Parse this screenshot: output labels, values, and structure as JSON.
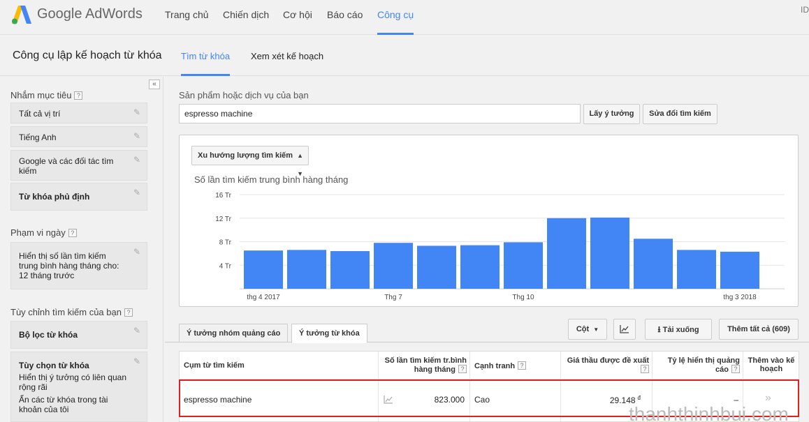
{
  "app": {
    "brand": "Google AdWords",
    "top_right": "ID"
  },
  "nav": {
    "items": [
      {
        "label": "Trang chủ",
        "active": false
      },
      {
        "label": "Chiến dịch",
        "active": false
      },
      {
        "label": "Cơ hội",
        "active": false
      },
      {
        "label": "Báo cáo",
        "active": false
      },
      {
        "label": "Công cụ",
        "active": true
      }
    ]
  },
  "subheader": {
    "title": "Công cụ lập kế hoạch từ khóa",
    "tabs": [
      {
        "label": "Tìm từ khóa",
        "active": true
      },
      {
        "label": "Xem xét kế hoạch",
        "active": false
      }
    ]
  },
  "sidebar": {
    "collapse": "«",
    "targeting": {
      "heading": "Nhắm mục tiêu",
      "help": "?",
      "items": [
        "Tất cả vị trí",
        "Tiếng Anh",
        "Google và các đối tác tìm kiếm",
        "Từ khóa phủ định"
      ]
    },
    "date_range": {
      "heading": "Phạm vi ngày",
      "help": "?",
      "text": "Hiển thị số lần tìm kiếm trung bình hàng tháng cho: 12 tháng trước"
    },
    "customize": {
      "heading": "Tùy chỉnh tìm kiếm của bạn",
      "help": "?",
      "filter": "Bộ lọc từ khóa",
      "options_title": "Tùy chọn từ khóa",
      "options_line1": "Hiển thị ý tưởng có liên quan rộng rãi",
      "options_line2": "Ẩn các từ khóa trong tài khoản của tôi"
    }
  },
  "search": {
    "label": "Sản phẩm hoặc dịch vụ của bạn",
    "value": "espresso machine",
    "get_ideas": "Lấy ý tưởng",
    "modify": "Sửa đổi tìm kiếm"
  },
  "chart": {
    "selector": "Xu hướng lượng tìm kiếm"
  },
  "chart_data": {
    "type": "bar",
    "title": "Số lần tìm kiếm trung bình hàng tháng",
    "yticks": [
      "4 Tr",
      "8 Tr",
      "12 Tr",
      "16 Tr"
    ],
    "ytick_values": [
      4,
      8,
      12,
      16
    ],
    "ylim": [
      0,
      16
    ],
    "xtick_labels": [
      "thg 4 2017",
      "Thg 7",
      "Thg 10",
      "thg 3 2018"
    ],
    "xtick_index": [
      0,
      3,
      6,
      11
    ],
    "values": [
      6.5,
      6.6,
      6.4,
      7.8,
      7.3,
      7.4,
      7.9,
      12,
      12.1,
      8.5,
      6.6,
      6.3
    ],
    "color": "#4285f4",
    "grid": true
  },
  "results": {
    "tabs": [
      {
        "label": "Ý tưởng nhóm quảng cáo",
        "active": false
      },
      {
        "label": "Ý tưởng từ khóa",
        "active": true
      }
    ],
    "columns_btn": "Cột",
    "download_btn": "Tải xuống",
    "add_all_btn": "Thêm tất cả (609)",
    "headers": {
      "keyword": "Cụm từ tìm kiếm",
      "volume_l1": "Số lần tìm kiếm tr.bình",
      "volume_l2": "hàng tháng",
      "competition": "Cạnh tranh",
      "bid_l1": "Giá thầu được đề xuất",
      "share_l1": "Tỷ lệ hiển thị quảng",
      "share_l2": "cáo",
      "add_l1": "Thêm vào kế",
      "add_l2": "hoạch",
      "help": "?"
    },
    "row": {
      "keyword": "espresso machine",
      "volume": "823.000",
      "competition": "Cao",
      "bid": "29.148",
      "currency": "đ",
      "share": "–",
      "add": "»"
    }
  },
  "watermark": "thanhthinhbui.com"
}
